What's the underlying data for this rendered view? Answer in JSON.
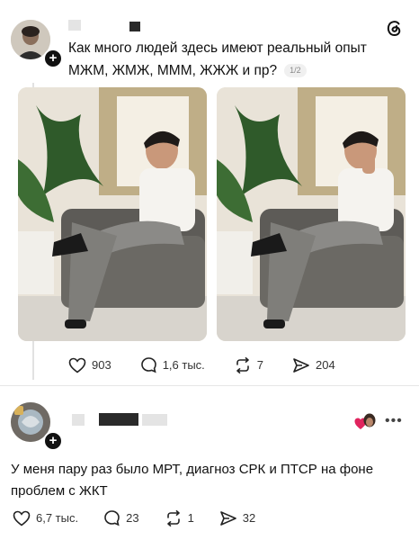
{
  "post": {
    "text_line1": "Как много людей здесь имеют реальный опыт",
    "text_line2": "МЖМ, ЖМЖ, МММ, ЖЖЖ и пр?",
    "image_counter": "1/2",
    "likes": "903",
    "comments": "1,6 тыс.",
    "reposts": "7",
    "shares": "204",
    "app_icon": "threads-logo-icon"
  },
  "reply": {
    "text_line1": "У меня пару раз было МРТ, диагноз СРК и ПТСР на фоне",
    "text_line2": "проблем с ЖКТ",
    "likes": "6,7 тыс.",
    "comments": "23",
    "reposts": "1",
    "shares": "32",
    "reaction_icon": "heart-sticker-icon",
    "more_icon": "more-dots-icon"
  },
  "colors": {
    "accent_like": "#e0245e",
    "text": "#111111",
    "muted": "#888888"
  }
}
